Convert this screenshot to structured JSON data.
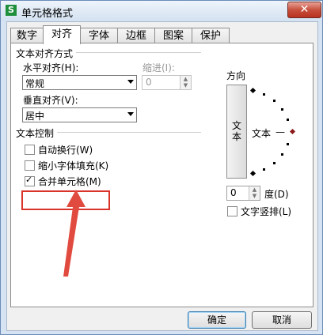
{
  "window": {
    "title": "单元格格式",
    "app_icon_text": "S",
    "close_symbol": "✕"
  },
  "tabs": [
    {
      "label": "数字"
    },
    {
      "label": "对齐",
      "active": true
    },
    {
      "label": "字体"
    },
    {
      "label": "边框"
    },
    {
      "label": "图案"
    },
    {
      "label": "保护"
    }
  ],
  "alignment": {
    "section_title": "文本对齐方式",
    "horizontal_label": "水平对齐(H):",
    "horizontal_value": "常规",
    "indent_label": "缩进(I):",
    "indent_value": "0",
    "vertical_label": "垂直对齐(V):",
    "vertical_value": "居中"
  },
  "text_control": {
    "section_title": "文本控制",
    "wrap_text": {
      "label": "自动换行(W)",
      "checked": false
    },
    "shrink_to_fit": {
      "label": "缩小字体填充(K)",
      "checked": false
    },
    "merge_cells": {
      "label": "合并单元格(M)",
      "checked": true
    }
  },
  "orientation": {
    "section_title": "方向",
    "vertical_text_button": "文本",
    "dial_text": "文本",
    "dial_line": "—",
    "degrees_value": "0",
    "degrees_label": "度(D)",
    "vertical_text_checkbox": {
      "label": "文字竖排(L)",
      "checked": false
    }
  },
  "buttons": {
    "ok": "确定",
    "cancel": "取消"
  },
  "annotation_color": "#d9342b"
}
